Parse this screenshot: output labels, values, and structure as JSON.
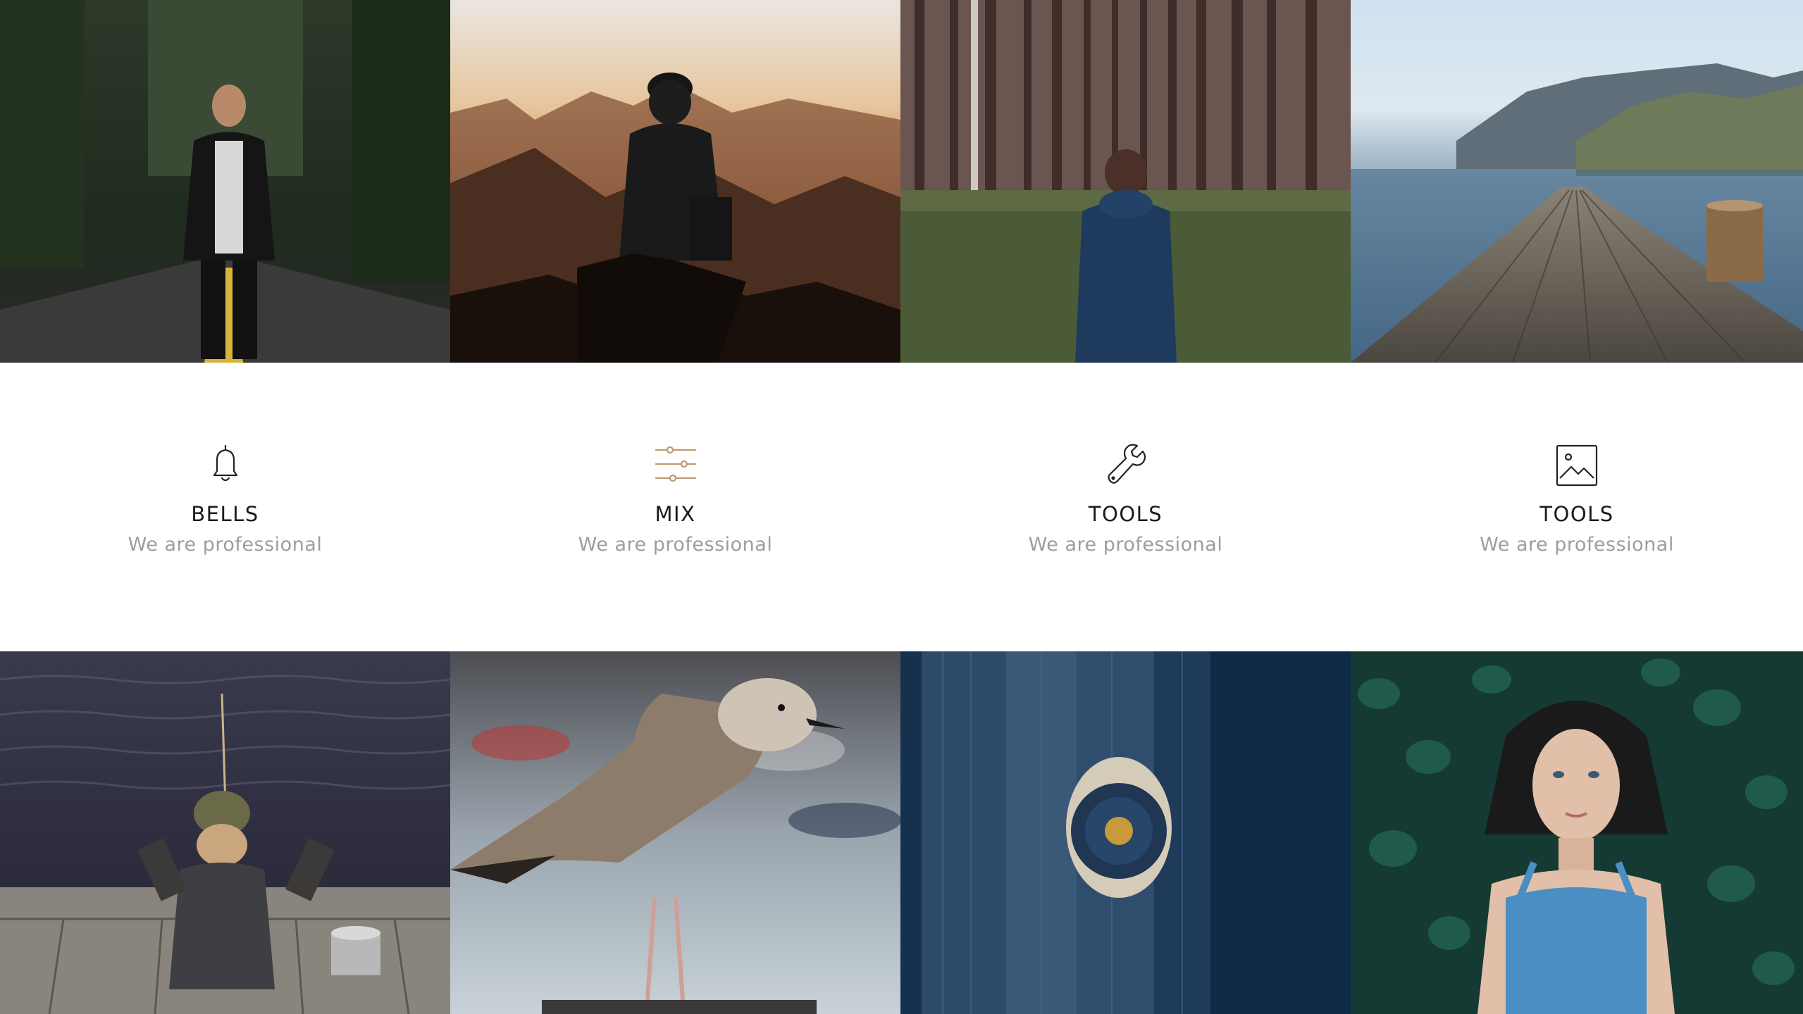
{
  "features": [
    {
      "title": "BELLS",
      "subtitle": "We are professional",
      "icon": "bell-icon",
      "icon_color": "#222222"
    },
    {
      "title": "MIX",
      "subtitle": "We are professional",
      "icon": "sliders-icon",
      "icon_color": "#c49a6c"
    },
    {
      "title": "TOOLS",
      "subtitle": "We are professional",
      "icon": "wrench-icon",
      "icon_color": "#222222"
    },
    {
      "title": "TOOLS",
      "subtitle": "We are professional",
      "icon": "image-icon",
      "icon_color": "#222222"
    }
  ],
  "top_photos": [
    {
      "subject": "man-on-forest-road-photo"
    },
    {
      "subject": "hiker-mountain-sunset-photo"
    },
    {
      "subject": "woman-in-pine-forest-photo"
    },
    {
      "subject": "wooden-dock-lake-photo"
    }
  ],
  "bottom_photos": [
    {
      "subject": "child-fishing-on-pier-photo"
    },
    {
      "subject": "seagull-photo"
    },
    {
      "subject": "blue-wooden-door-bell-photo"
    },
    {
      "subject": "woman-in-ivy-photo"
    }
  ],
  "colors": {
    "accent": "#c49a6c",
    "title_text": "#1b1b1b",
    "subtitle_text": "#9d9d9d"
  }
}
